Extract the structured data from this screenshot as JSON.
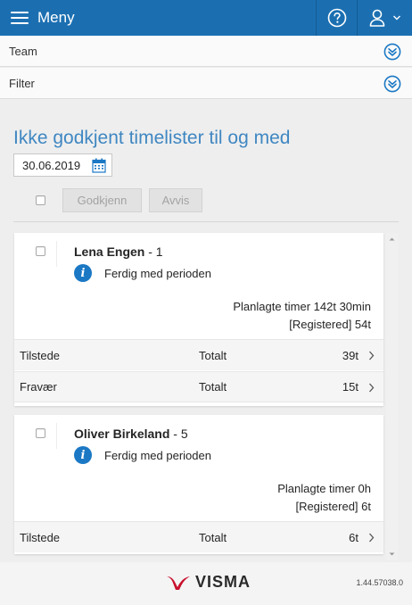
{
  "topbar": {
    "menu_label": "Meny",
    "help_icon": "question-circle-icon",
    "user_icon": "user-icon",
    "background": "#1b6fb1"
  },
  "panels": [
    {
      "label": "Team",
      "icon": "double-chevron-down-icon"
    },
    {
      "label": "Filter",
      "icon": "double-chevron-down-icon"
    }
  ],
  "main": {
    "title": "Ikke godkjent timelister til og med",
    "date_value": "30.06.2019",
    "approve_label": "Godkjenn",
    "reject_label": "Avvis",
    "accent_color": "#3f87c2"
  },
  "timesheets": [
    {
      "name": "Lena Engen",
      "count": " - 1",
      "status": "Ferdig med perioden",
      "planned": "Planlagte timer 142t 30min",
      "registered": "[Registered] 54t",
      "rows": [
        {
          "label": "Tilstede",
          "total_label": "Totalt",
          "value": "39t"
        },
        {
          "label": "Fravær",
          "total_label": "Totalt",
          "value": "15t"
        }
      ]
    },
    {
      "name": "Oliver Birkeland",
      "count": " - 5",
      "status": "Ferdig med perioden",
      "planned": "Planlagte timer 0h",
      "registered": "[Registered] 6t",
      "rows": [
        {
          "label": "Tilstede",
          "total_label": "Totalt",
          "value": "6t"
        }
      ]
    }
  ],
  "footer": {
    "logo_text": "VISMA",
    "version": "1.44.57038.0",
    "logo_color": "#c8102e"
  }
}
